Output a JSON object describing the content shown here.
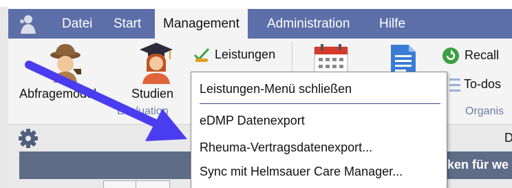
{
  "menubar": {
    "items": [
      {
        "label": "Datei"
      },
      {
        "label": "Start"
      },
      {
        "label": "Management"
      },
      {
        "label": "Administration"
      },
      {
        "label": "Hilfe"
      }
    ]
  },
  "ribbon": {
    "abfrage_label": "Abfragemodul",
    "studien_label": "Studien",
    "leistungen_label": "Leistungen",
    "recall_label": "Recall",
    "todos_label": "To-dos",
    "group_evaluation": "Evaluation",
    "group_organisation": "Organis"
  },
  "lower": {
    "header_text": "ken für we",
    "right_letter": "D"
  },
  "dropdown": {
    "items": [
      {
        "label": "Leistungen-Menü schließen"
      },
      {
        "label": "eDMP Datenexport"
      },
      {
        "label": "Rheuma-Vertragsdatenexport..."
      },
      {
        "label": "Sync mit Helmsauer Care Manager..."
      }
    ]
  },
  "colors": {
    "menubar": "#5d6fa8",
    "annotation_arrow": "#4a3df0"
  }
}
